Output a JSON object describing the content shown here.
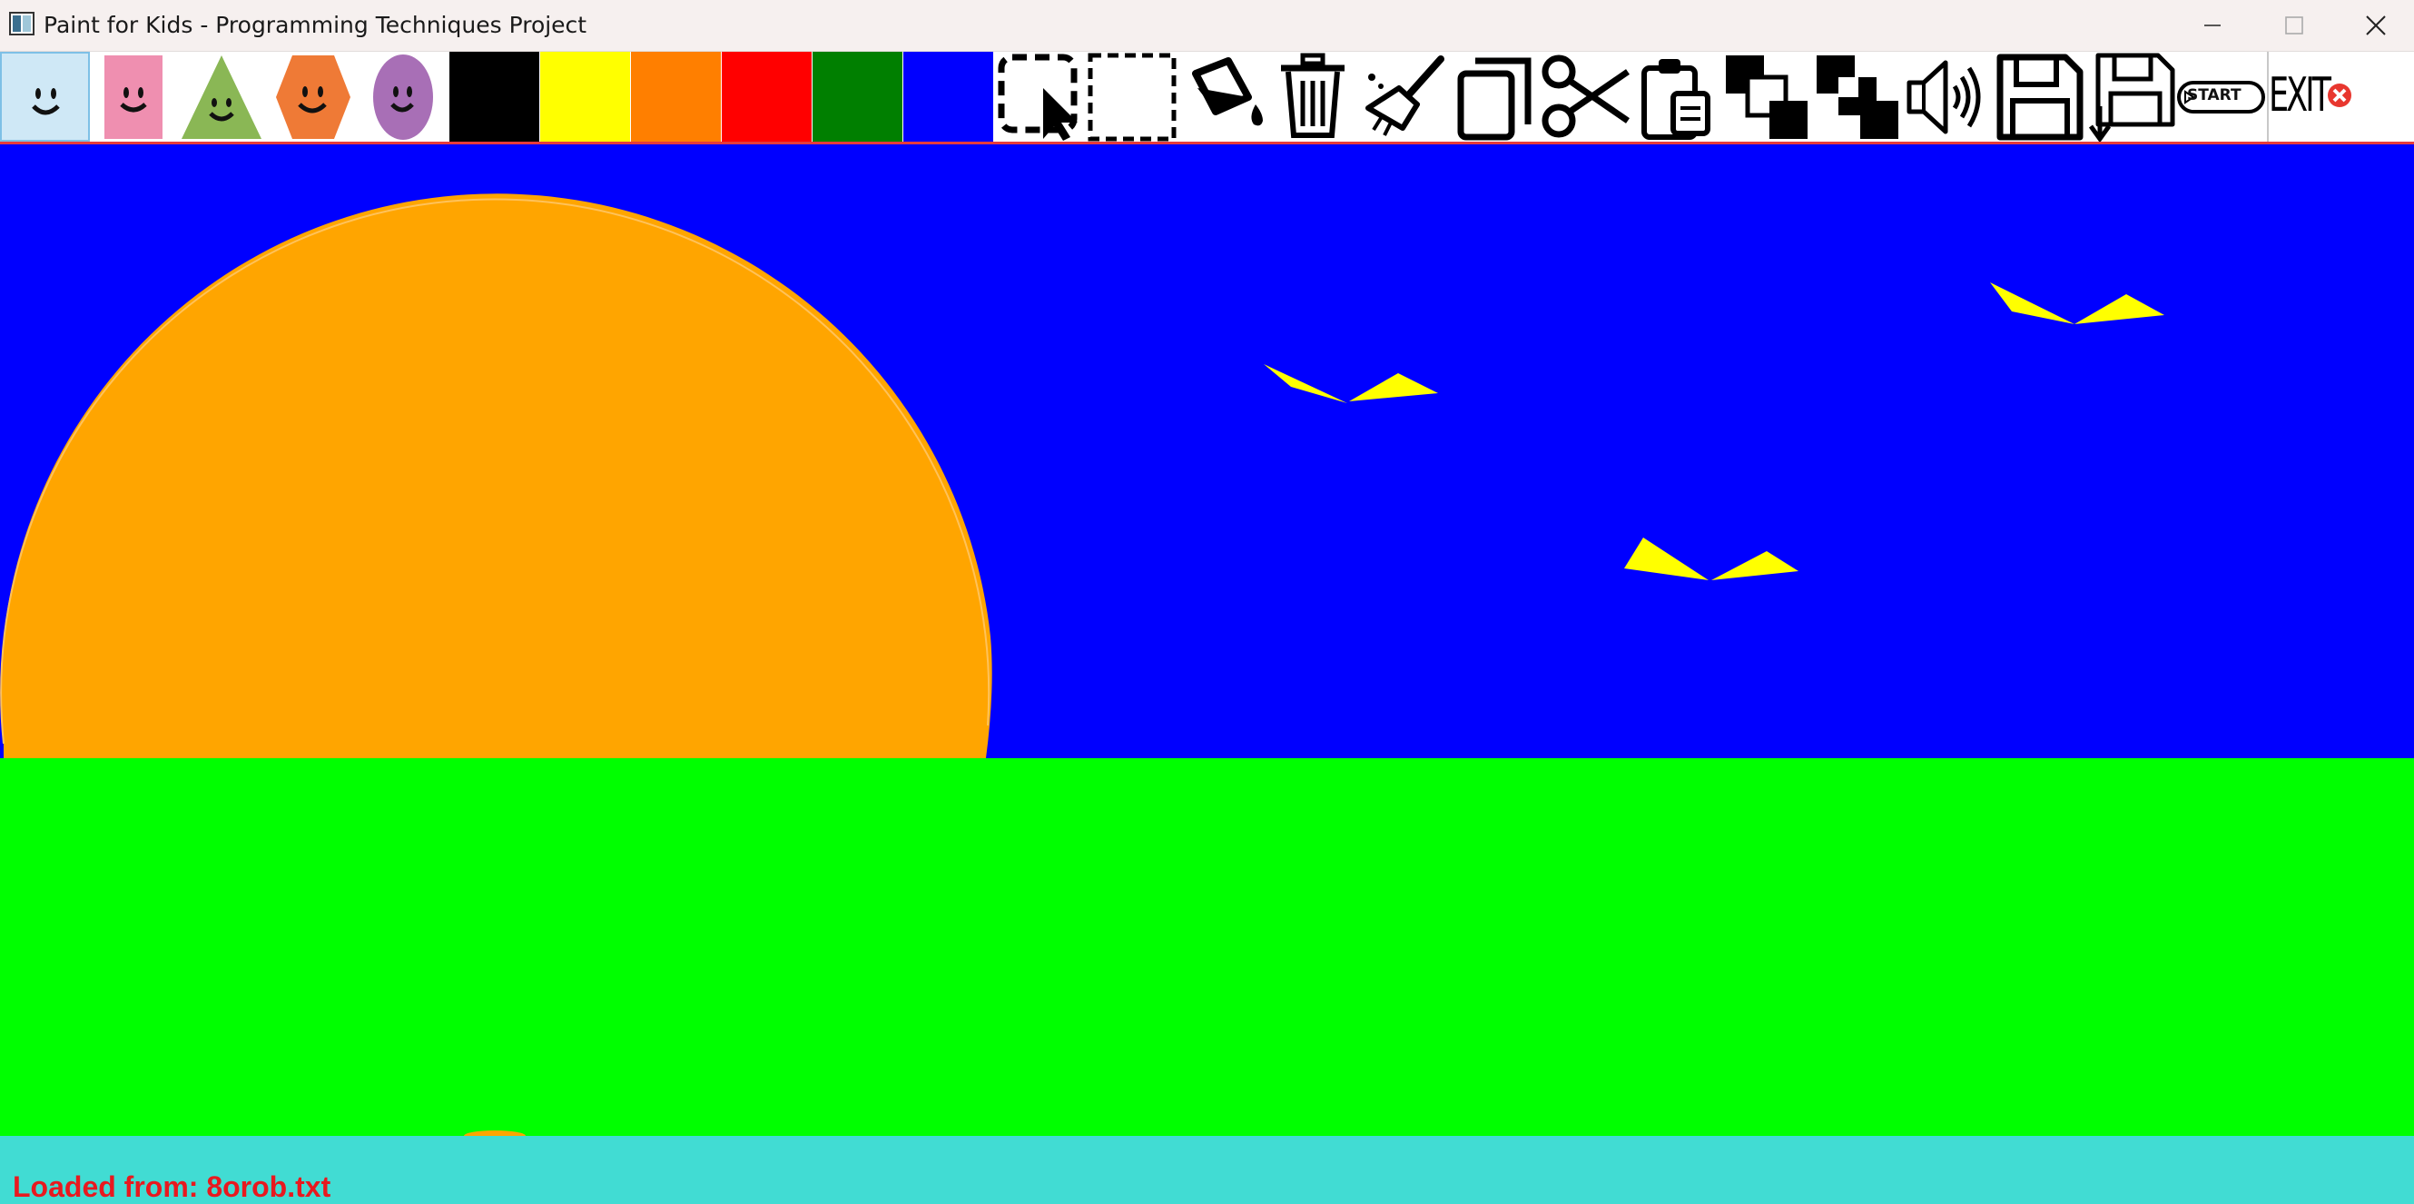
{
  "window": {
    "title": "Paint for Kids - Programming Techniques Project",
    "controls": [
      "minimize",
      "maximize",
      "close"
    ]
  },
  "toolbar": {
    "shape_tools": [
      {
        "name": "square-shape",
        "icon": "smiley-square-icon",
        "color": "#cfe8f6",
        "selected": true
      },
      {
        "name": "rectangle-shape",
        "icon": "smiley-rectangle-icon",
        "color": "#ef8fb0"
      },
      {
        "name": "triangle-shape",
        "icon": "smiley-triangle-icon",
        "color": "#8ab755"
      },
      {
        "name": "hexagon-shape",
        "icon": "smiley-hexagon-icon",
        "color": "#ef7a36"
      },
      {
        "name": "circle-shape",
        "icon": "smiley-circle-icon",
        "color": "#a86fb6"
      }
    ],
    "colors": [
      "#000000",
      "#ffff00",
      "#ff7f00",
      "#ff0000",
      "#007f00",
      "#0000ff"
    ],
    "action_tools": [
      {
        "name": "select",
        "icon": "select-arrow-icon"
      },
      {
        "name": "select-area",
        "icon": "dashed-rectangle-icon"
      },
      {
        "name": "fill",
        "icon": "paint-bucket-icon"
      },
      {
        "name": "delete",
        "icon": "trash-icon"
      },
      {
        "name": "clear",
        "icon": "broom-icon"
      },
      {
        "name": "copy",
        "icon": "copy-icon"
      },
      {
        "name": "cut",
        "icon": "scissors-icon"
      },
      {
        "name": "paste",
        "icon": "clipboard-icon"
      },
      {
        "name": "bring-to-front",
        "icon": "bring-front-icon"
      },
      {
        "name": "send-to-back",
        "icon": "send-back-icon"
      },
      {
        "name": "sound",
        "icon": "speaker-icon"
      },
      {
        "name": "save",
        "icon": "floppy-icon"
      },
      {
        "name": "load",
        "icon": "floppy-load-icon"
      },
      {
        "name": "start-play",
        "icon": "start-icon",
        "label": "START"
      },
      {
        "name": "exit",
        "icon": "exit-icon",
        "label": "EXIT"
      }
    ]
  },
  "drawing": {
    "sky_color": "#0000ff",
    "ground_color": "#00ff00",
    "sun_color": "#ffa500",
    "bird_color": "#ffff00",
    "bird_count": 3
  },
  "status": {
    "message": "Loaded from: 8orob.txt",
    "color": "#e8191f"
  }
}
